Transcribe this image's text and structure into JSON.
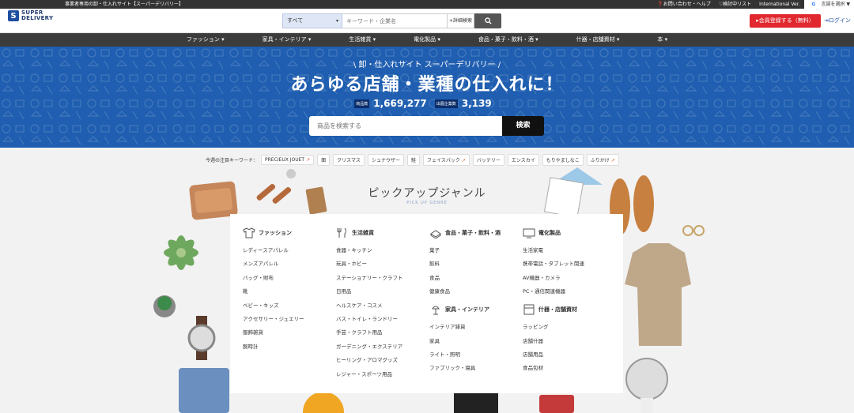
{
  "topbar": {
    "tagline": "事業者専用の卸・仕入れサイト【スーパーデリバリー】",
    "help": "❓お問い合わせ・ヘルプ",
    "wishlist": "♡検討中リスト",
    "international": "International Ver.",
    "language": "言語を選択 ▼"
  },
  "header": {
    "logo_line1": "SUPER",
    "logo_line2": "DELIVERY",
    "search_category": "すべて",
    "search_placeholder": "キーワード・企業名",
    "advanced_search": "+詳細検索",
    "register_button": "▸会員登録する（無料）",
    "login": "ログイン"
  },
  "nav": {
    "items": [
      "ファッション ▾",
      "家具・インテリア ▾",
      "生活雑貨 ▾",
      "電化製品 ▾",
      "食品・菓子・飲料・酒 ▾",
      "什器・店舗資材 ▾",
      "本 ▾"
    ]
  },
  "hero": {
    "subtitle": "\\ 卸・仕入れサイト スーパーデリバリー /",
    "title": "あらゆる店舗・業種の仕入れに！",
    "products_label": "商品数",
    "products_count": "1,669,277",
    "companies_label": "出展企業数",
    "companies_count": "3,139",
    "search_placeholder": "商品を検索する",
    "search_button": "検索"
  },
  "keywords": {
    "label": "今週の注目キーワード：",
    "items": [
      "PRECIEUX JOUET",
      "面",
      "クリスマス",
      "シュナウザー",
      "鮭",
      "フェイスパック",
      "バッテリー",
      "エンスカイ",
      "もりやましなこ",
      "ふりかけ"
    ],
    "trending_icon": "trending-up-icon"
  },
  "genre": {
    "title": "ピックアップジャンル",
    "subtitle": "PICK UP GENRE",
    "columns": [
      {
        "heading": "ファッション",
        "icon": "tshirt-icon",
        "links": [
          "レディースアパレル",
          "メンズアパレル",
          "バッグ・財布",
          "靴",
          "ベビー・キッズ",
          "アクセサリー・ジュエリー",
          "服飾雑貨",
          "腕時計"
        ]
      },
      {
        "heading": "生活雑貨",
        "icon": "utensils-icon",
        "links": [
          "食器・キッチン",
          "玩具・ホビー",
          "ステーショナリー・クラフト",
          "日用品",
          "ヘルスケア・コスメ",
          "バス・トイレ・ランドリー",
          "手芸・クラフト用品",
          "ガーデニング・エクステリア",
          "ヒーリング・アロマグッズ",
          "レジャー・スポーツ用品"
        ]
      },
      {
        "heading": "食品・菓子・飲料・酒",
        "icon": "food-icon",
        "links": [
          "菓子",
          "飲料",
          "食品",
          "健康食品"
        ],
        "heading2": "家具・インテリア",
        "icon2": "lamp-icon",
        "links2": [
          "インテリア雑貨",
          "家具",
          "ライト・照明",
          "ファブリック・寝具"
        ]
      },
      {
        "heading": "電化製品",
        "icon": "tv-icon",
        "links": [
          "生活家電",
          "携帯電話・タブレット関連",
          "AV機器・カメラ",
          "PC・通信関連機器"
        ],
        "heading2": "什器・店舗資材",
        "icon2": "box-icon",
        "links2": [
          "ラッピング",
          "店舗什器",
          "店舗用品",
          "食品包材"
        ]
      }
    ]
  }
}
